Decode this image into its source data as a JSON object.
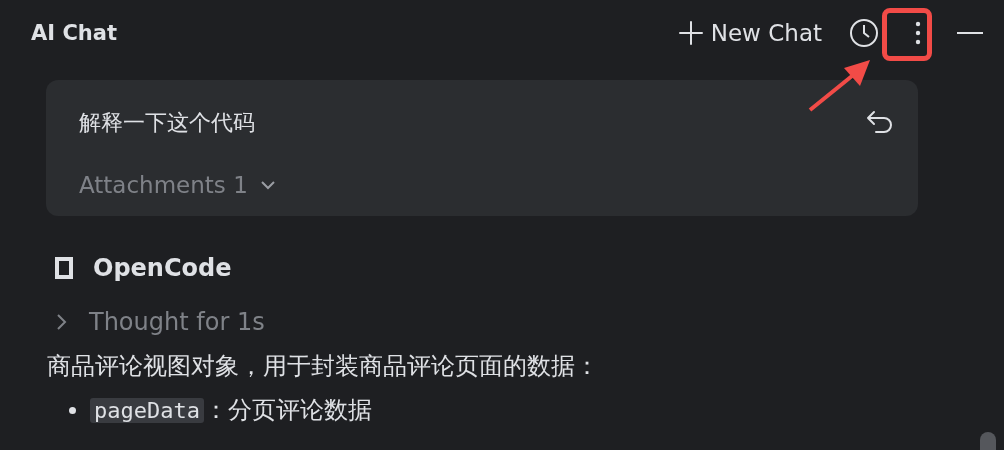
{
  "header": {
    "title": "AI Chat",
    "new_chat": "New Chat",
    "more_highlighted": true
  },
  "prompt": {
    "text": "解释一下这个代码",
    "attachments": "Attachments 1"
  },
  "response": {
    "agent": "OpenCode",
    "thought": {
      "label": "Thought for 1s",
      "expanded": false
    },
    "paragraph": "商品评论视图对象，用于封装商品评论页面的数据：",
    "bullets": [
      {
        "code": "pageData",
        "text": "：分页评论数据"
      }
    ]
  }
}
